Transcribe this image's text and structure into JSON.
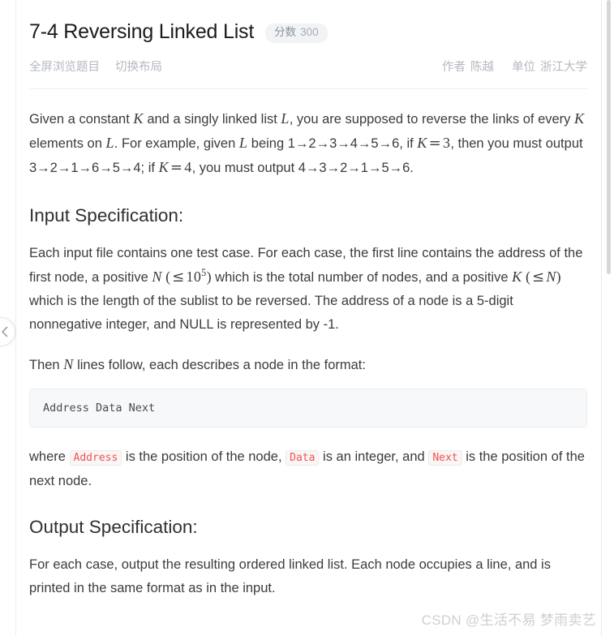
{
  "header": {
    "title": "7-4 Reversing Linked List",
    "badge": {
      "label": "分数",
      "value": "300"
    }
  },
  "meta": {
    "actions": [
      {
        "name": "fullscreen-view",
        "label": "全屏浏览题目"
      },
      {
        "name": "toggle-layout",
        "label": "切换布局"
      }
    ],
    "author": {
      "key": "作者",
      "value": "陈越"
    },
    "organization": {
      "key": "单位",
      "value": "浙江大学"
    }
  },
  "intro": {
    "t1": "Given a constant ",
    "k1": "K",
    "t2": " and a singly linked list ",
    "l1": "L",
    "t3": ", you are supposed to reverse the links of every ",
    "k2": "K",
    "t4": " elements on ",
    "l2": "L",
    "t5": ". For example, given ",
    "l3": "L",
    "t6": " being 1→2→3→4→5→6, if ",
    "eq1_var": "K",
    "eq1_op": "=",
    "eq1_val": "3",
    "t7": ", then you must output 3→2→1→6→5→4; if ",
    "eq2_var": "K",
    "eq2_op": "=",
    "eq2_val": "4",
    "t8": ", you must output 4→3→2→1→5→6."
  },
  "input_spec": {
    "heading": "Input Specification:",
    "p1_a": "Each input file contains one test case. For each case, the first line contains the address of the first node, a positive ",
    "p1_n": "N",
    "p1_le": "≤",
    "p1_base": "10",
    "p1_exp": "5",
    "p1_b": " which is the total number of nodes, and a positive ",
    "p1_k": "K",
    "p1_le2": "≤",
    "p1_n2": "N",
    "p1_c": " which is the length of the sublist to be reversed. The address of a node is a 5-digit nonnegative integer, and NULL is represented by -1.",
    "p2_a": "Then ",
    "p2_n": "N",
    "p2_b": " lines follow, each describes a node in the format:",
    "code_block": "Address Data Next",
    "p3_a": "where ",
    "p3_c1": "Address",
    "p3_b": " is the position of the node, ",
    "p3_c2": "Data",
    "p3_c": " is an integer, and ",
    "p3_c3": "Next",
    "p3_d": " is the position of the next node."
  },
  "output_spec": {
    "heading": "Output Specification:",
    "p1": "For each case, output the resulting ordered linked list. Each node occupies a line, and is printed in the same format as in the input."
  },
  "watermark": "CSDN @生活不易 梦雨卖艺",
  "colors": {
    "accent_code": "#ef5350",
    "badge_bg": "#f2f3f5",
    "muted": "#b4b9c0"
  }
}
